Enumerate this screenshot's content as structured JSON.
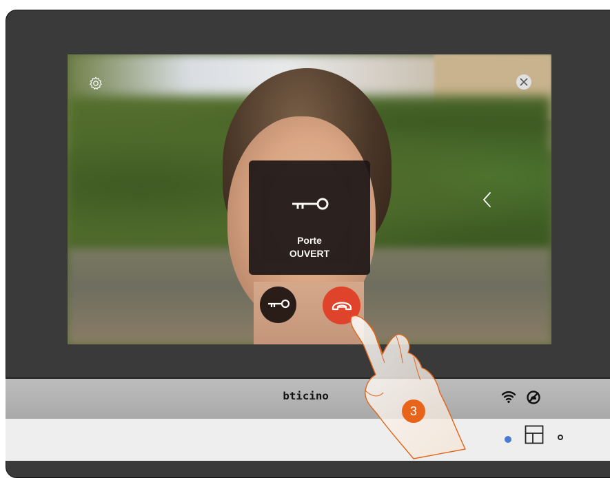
{
  "popup": {
    "title": "Porte",
    "status": "OUVERT"
  },
  "brand": {
    "logo_text": "bticino"
  },
  "tutorial": {
    "step_number": "3"
  },
  "icons": {
    "settings": "gear-icon",
    "close": "close-icon",
    "back": "chevron-left-icon",
    "door_unlock": "key-icon",
    "end_call": "hang-up-icon",
    "wifi": "wifi-icon",
    "mute": "ringtone-off-icon",
    "home": "home-key-icon"
  },
  "colors": {
    "end_call": "#e0432b",
    "step_badge": "#e8641b",
    "led": "#4a7ad1"
  }
}
